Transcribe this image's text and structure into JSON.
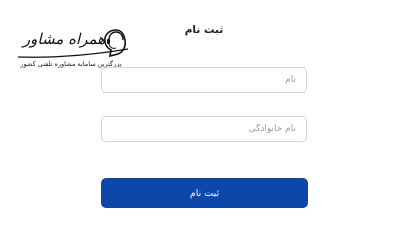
{
  "brand": {
    "name": "همراه مشاور",
    "tagline": "بزرگترین سامانه مشاوره تلفنی کشور"
  },
  "form": {
    "title": "ثبت نام",
    "first_name_placeholder": "نام",
    "last_name_placeholder": "نام خانوادگی",
    "submit_label": "ثبت نام"
  },
  "colors": {
    "accent": "#0d47a9",
    "field_border": "#d6d6d6"
  }
}
